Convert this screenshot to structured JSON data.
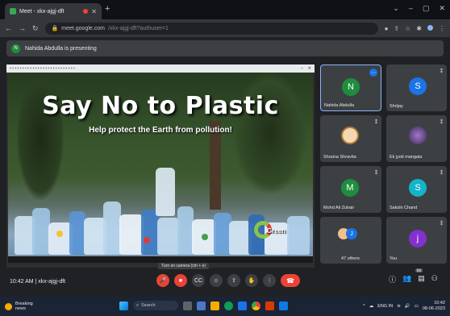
{
  "browser": {
    "tab_title": "Meet - xkx-ajgj-dft",
    "address": "meet.google.com",
    "address_rest": "/xkx-ajgj-dft?authuser=1"
  },
  "banner": {
    "avatar_letter": "N",
    "text": "Nahida Abdulla is presenting"
  },
  "slide": {
    "title": "Say No to Plastic",
    "subtitle": "Help protect the Earth from pollution!",
    "watermark": "Green"
  },
  "participants": [
    {
      "name": "Nahida Abdulla",
      "letter": "N",
      "color": "#1e8e3e"
    },
    {
      "name": "Shrijay",
      "letter": "S",
      "color": "#1a73e8"
    },
    {
      "name": "Shraina Shravita",
      "letter": "",
      "color": ""
    },
    {
      "name": "Ek jyoti mangala",
      "letter": "",
      "color": ""
    },
    {
      "name": "Mohd Ali Zuhair",
      "letter": "M",
      "color": "#1e8e3e"
    },
    {
      "name": "Sakshi Chand",
      "letter": "S",
      "color": "#12b5cb"
    },
    {
      "name": "47 others",
      "letter": "",
      "color": ""
    },
    {
      "name": "You",
      "letter": "j",
      "color": "#8430ce"
    }
  ],
  "meeting": {
    "time_code": "10:42 AM  |  xkx-ajgj-dft",
    "tooltip": "Turn on camera (ctrl + e)",
    "people_count": "50"
  },
  "taskbar": {
    "weather_temp": "Breaking",
    "weather_desc": "news",
    "search": "Search",
    "lang": "ENG IN",
    "time": "10:42",
    "date": "08-06-2023"
  }
}
